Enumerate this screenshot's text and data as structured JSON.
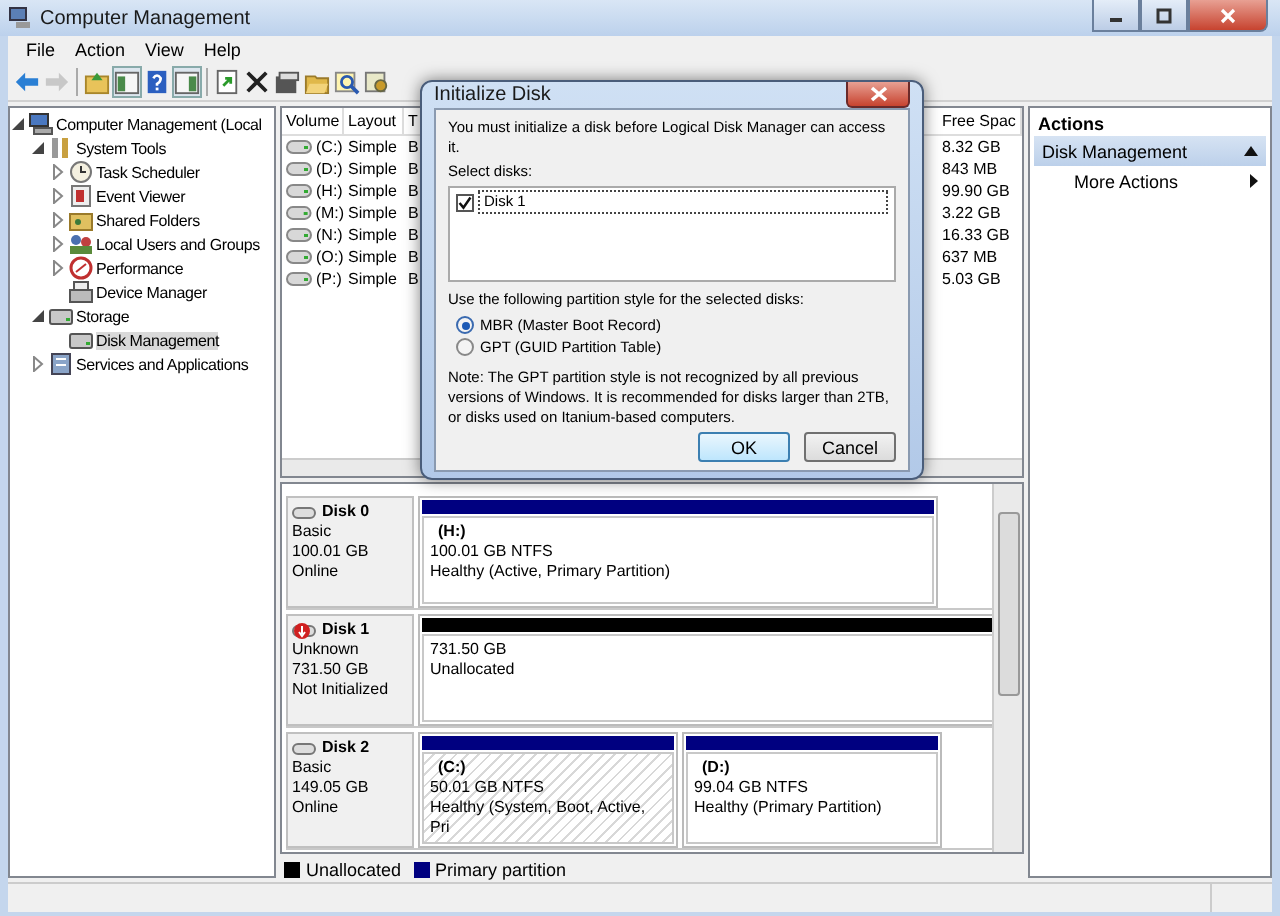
{
  "window": {
    "title": "Computer Management"
  },
  "menu": [
    "File",
    "Action",
    "View",
    "Help"
  ],
  "toolbar": [
    [
      {
        "kind": "back",
        "disabled": false,
        "pressed": false
      },
      {
        "kind": "forward",
        "disabled": true,
        "pressed": false
      }
    ],
    [
      {
        "kind": "up",
        "disabled": false,
        "pressed": false
      },
      {
        "kind": "tree",
        "disabled": false,
        "pressed": true
      },
      {
        "kind": "help",
        "disabled": false,
        "pressed": false
      },
      {
        "kind": "pane",
        "disabled": false,
        "pressed": true
      }
    ],
    [
      {
        "kind": "export",
        "disabled": false,
        "pressed": false
      },
      {
        "kind": "delete",
        "disabled": false,
        "pressed": false
      },
      {
        "kind": "properties",
        "disabled": false,
        "pressed": false
      },
      {
        "kind": "open",
        "disabled": false,
        "pressed": false
      },
      {
        "kind": "search",
        "disabled": false,
        "pressed": false
      },
      {
        "kind": "settings",
        "disabled": false,
        "pressed": false
      }
    ]
  ],
  "tree": {
    "items": [
      {
        "label": "Computer Management (Local",
        "kind": "computer",
        "expanded": true,
        "selected": false,
        "children": [
          {
            "label": "System Tools",
            "kind": "tools",
            "expanded": true,
            "selected": false,
            "children": [
              {
                "label": "Task Scheduler",
                "kind": "clock",
                "expanded": false,
                "selected": false
              },
              {
                "label": "Event Viewer",
                "kind": "event",
                "expanded": false,
                "selected": false
              },
              {
                "label": "Shared Folders",
                "kind": "share",
                "expanded": false,
                "selected": false
              },
              {
                "label": "Local Users and Groups",
                "kind": "users",
                "expanded": false,
                "selected": false
              },
              {
                "label": "Performance",
                "kind": "perf",
                "expanded": false,
                "selected": false
              },
              {
                "label": "Device Manager",
                "kind": "device",
                "selected": false
              }
            ]
          },
          {
            "label": "Storage",
            "kind": "storage",
            "expanded": true,
            "selected": false,
            "children": [
              {
                "label": "Disk Management",
                "kind": "disk",
                "selected": true
              }
            ]
          },
          {
            "label": "Services and Applications",
            "kind": "services",
            "expanded": false,
            "selected": false
          }
        ]
      }
    ]
  },
  "volume_list": {
    "columns": [
      "Volume",
      "Layout",
      "T",
      "Free Spac"
    ],
    "rows": [
      {
        "volume": "(C:)",
        "layout": "Simple",
        "type": "B",
        "free": "8.32 GB"
      },
      {
        "volume": "(D:)",
        "layout": "Simple",
        "type": "B",
        "free": "843 MB"
      },
      {
        "volume": "(H:)",
        "layout": "Simple",
        "type": "B",
        "free": "99.90 GB"
      },
      {
        "volume": "(M:)",
        "layout": "Simple",
        "type": "B",
        "free": "3.22 GB"
      },
      {
        "volume": "(N:)",
        "layout": "Simple",
        "type": "B",
        "free": "16.33 GB"
      },
      {
        "volume": "(O:)",
        "layout": "Simple",
        "type": "B",
        "free": "637 MB"
      },
      {
        "volume": "(P:)",
        "layout": "Simple",
        "type": "B",
        "free": "5.03 GB"
      }
    ]
  },
  "disks": [
    {
      "name": "Disk 0",
      "kind": "normal",
      "type": "Basic",
      "size": "100.01 GB",
      "status": "Online",
      "partitions": [
        {
          "kind": "primary",
          "color": "#000080",
          "label": "(H:)",
          "size": "100.01 GB NTFS",
          "status": "Healthy (Active, Primary Partition)",
          "selected": false
        }
      ]
    },
    {
      "name": "Disk 1",
      "kind": "error",
      "type": "Unknown",
      "size": "731.50 GB",
      "status": "Not Initialized",
      "partitions": [
        {
          "kind": "unallocated",
          "color": "#000000",
          "size": "731.50 GB",
          "status": "Unallocated",
          "selected": false
        }
      ]
    },
    {
      "name": "Disk 2",
      "kind": "normal",
      "type": "Basic",
      "size": "149.05 GB",
      "status": "Online",
      "partitions": [
        {
          "kind": "primary",
          "color": "#000080",
          "label": "(C:)",
          "size": "50.01 GB NTFS",
          "status": "Healthy (System, Boot, Active, Pri",
          "selected": true
        },
        {
          "kind": "primary",
          "color": "#000080",
          "label": "(D:)",
          "size": "99.04 GB NTFS",
          "status": "Healthy (Primary Partition)",
          "selected": false
        }
      ]
    }
  ],
  "legend": [
    {
      "label": "Unallocated",
      "color": "#000000"
    },
    {
      "label": "Primary partition",
      "color": "#000080"
    }
  ],
  "actions": {
    "title": "Actions",
    "items": [
      {
        "label": "Disk Management",
        "kind": "section",
        "expanded": true
      },
      {
        "label": "More Actions",
        "kind": "submenu"
      }
    ]
  },
  "dialog": {
    "title": "Initialize Disk",
    "message": "You must initialize a disk before Logical Disk Manager can access it.",
    "select_label": "Select disks:",
    "disks": [
      {
        "label": "Disk 1",
        "checked": true
      }
    ],
    "style_label": "Use the following partition style for the selected disks:",
    "styles": [
      {
        "label": "MBR (Master Boot Record)",
        "selected": true
      },
      {
        "label": "GPT (GUID Partition Table)",
        "selected": false
      }
    ],
    "note": "Note: The GPT partition style is not recognized by all previous versions of Windows. It is recommended for disks larger than 2TB, or disks used on Itanium-based computers.",
    "buttons": [
      {
        "label": "OK",
        "default": true
      },
      {
        "label": "Cancel",
        "default": false
      }
    ]
  }
}
